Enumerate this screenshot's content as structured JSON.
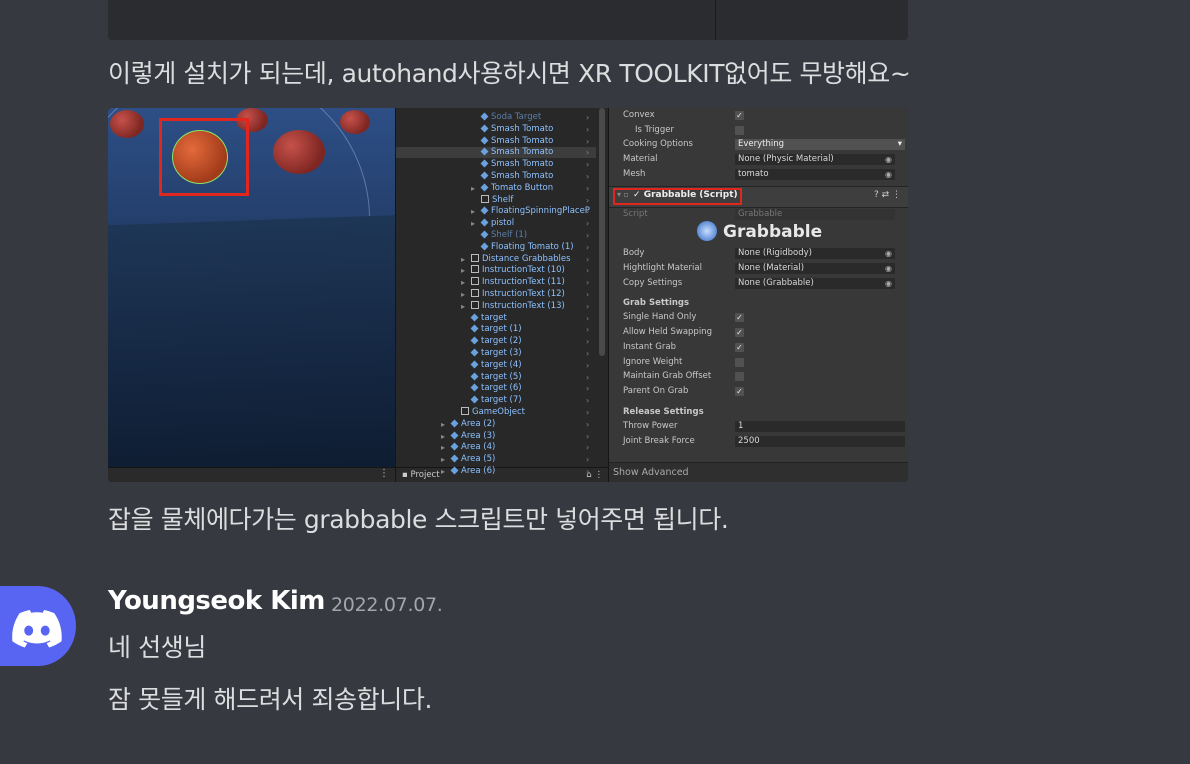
{
  "messages": {
    "line1": "이렇게 설치가 되는데, autohand사용하시면 XR TOOLKIT없어도 무방해요~",
    "line2": "잡을 물체에다가는 grabbable 스크립트만 넣어주면 됩니다.",
    "reply1": "네 선생님",
    "reply2": "잠 못들게 해드려서 죄송합니다."
  },
  "author": {
    "name": "Youngseok Kim",
    "timestamp": "2022.07.07.",
    "avatar_icon": "discord-logo-icon",
    "avatar_color": "#5865f2"
  },
  "screenshot": {
    "hierarchy": [
      {
        "label": "Soda Target",
        "dim": true
      },
      {
        "label": "Smash Tomato"
      },
      {
        "label": "Smash Tomato"
      },
      {
        "label": "Smash Tomato",
        "selected": true
      },
      {
        "label": "Smash Tomato"
      },
      {
        "label": "Smash Tomato"
      },
      {
        "label": "Tomato Button"
      },
      {
        "label": "Shelf"
      },
      {
        "label": "FloatingSpinningPlaceP"
      },
      {
        "label": "pistol"
      },
      {
        "label": "Shelf (1)",
        "dim": true
      },
      {
        "label": "Floating Tomato (1)"
      },
      {
        "label": "Distance Grabbables"
      },
      {
        "label": "InstructionText (10)"
      },
      {
        "label": "InstructionText (11)"
      },
      {
        "label": "InstructionText (12)"
      },
      {
        "label": "InstructionText (13)"
      },
      {
        "label": "target"
      },
      {
        "label": "target (1)"
      },
      {
        "label": "target (2)"
      },
      {
        "label": "target (3)"
      },
      {
        "label": "target (4)"
      },
      {
        "label": "target (5)"
      },
      {
        "label": "target (6)"
      },
      {
        "label": "target (7)"
      },
      {
        "label": "GameObject"
      },
      {
        "label": "Area (2)"
      },
      {
        "label": "Area (3)"
      },
      {
        "label": "Area (4)"
      },
      {
        "label": "Area (5)"
      },
      {
        "label": "Area (6)"
      }
    ],
    "project_tab": "Project",
    "inspector": {
      "convex": "Convex",
      "is_trigger": "Is Trigger",
      "cooking_options": "Cooking Options",
      "cooking_value": "Everything",
      "material": "Material",
      "material_value": "None (Physic Material)",
      "mesh": "Mesh",
      "mesh_value": "tomato",
      "component_title": "Grabbable (Script)",
      "script": "Script",
      "script_value": "Grabbable",
      "logo_text": "Grabbable",
      "body": "Body",
      "body_value": "None (Rigidbody)",
      "highlight": "Hightlight Material",
      "highlight_value": "None (Material)",
      "copy": "Copy Settings",
      "copy_value": "None (Grabbable)",
      "grab_settings": "Grab Settings",
      "single_hand": "Single Hand Only",
      "allow_held": "Allow Held Swapping",
      "instant_grab": "Instant Grab",
      "ignore_weight": "Ignore Weight",
      "maintain_offset": "Maintain Grab Offset",
      "parent_on_grab": "Parent On Grab",
      "release_settings": "Release Settings",
      "throw_power": "Throw Power",
      "throw_value": "1",
      "joint_break": "Joint Break Force",
      "joint_value": "2500",
      "show_advanced": "Show Advanced"
    }
  }
}
